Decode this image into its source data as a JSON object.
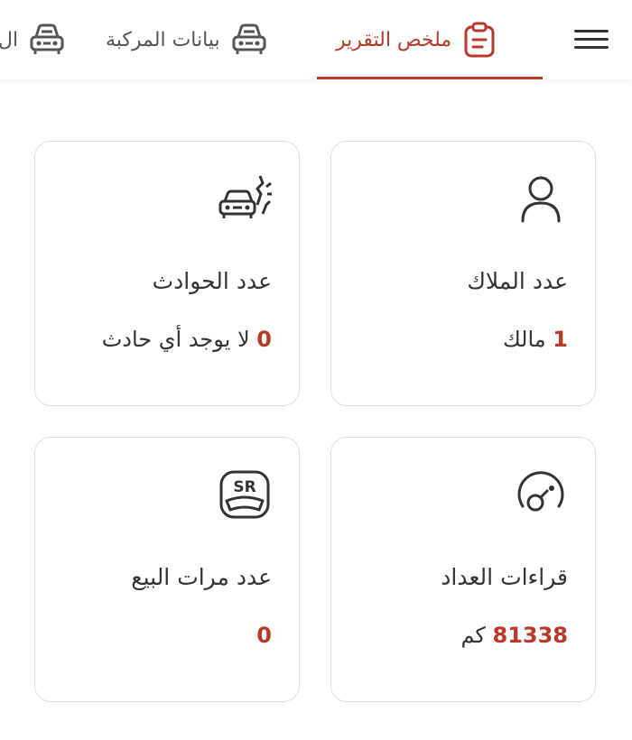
{
  "header": {
    "tabs": [
      {
        "label": "ملخص التقرير",
        "icon": "clipboard-icon",
        "active": true
      },
      {
        "label": "بيانات المركبة",
        "icon": "car-icon",
        "active": false
      },
      {
        "label": "ال",
        "icon": "car-icon",
        "active": false
      }
    ],
    "menu_icon": "hamburger-menu-icon"
  },
  "cards": {
    "owners": {
      "label": "عدد الملاك",
      "value": "1",
      "value_suffix": "مالك",
      "icon": "person-icon"
    },
    "accidents": {
      "label": "عدد الحوادث",
      "value": "0",
      "value_suffix": "لا يوجد أي حادث",
      "icon": "car-crash-icon"
    },
    "odometer": {
      "label": "قراءات العداد",
      "value": "81338",
      "value_suffix": "كم",
      "icon": "odometer-icon"
    },
    "sales": {
      "label": "عدد مرات البيع",
      "value": "0",
      "value_suffix": "",
      "icon": "sr-badge-icon",
      "icon_text": "SR"
    }
  },
  "colors": {
    "accent": "#b8382a",
    "text": "#333333",
    "border": "#dedede"
  }
}
